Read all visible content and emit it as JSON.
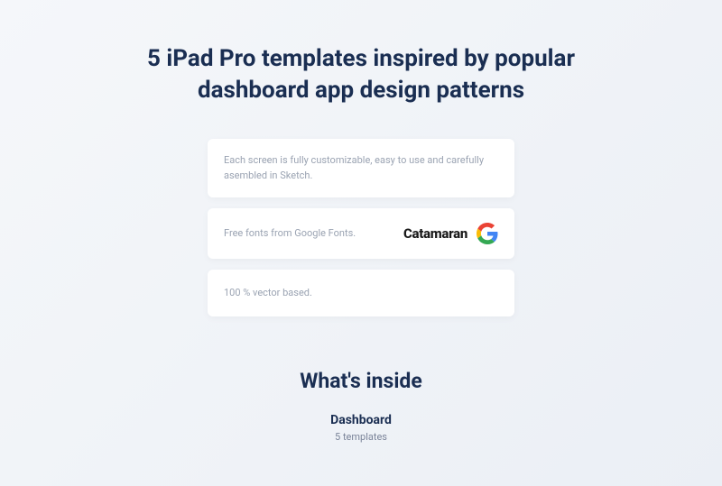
{
  "heading": "5 iPad Pro templates inspired by popular dashboard app design patterns",
  "cards": {
    "card1": "Each screen is fully customizable, easy to use and carefully asembled in Sketch.",
    "card2_text": "Free fonts from Google Fonts.",
    "card2_font": "Catamaran",
    "card3": "100 % vector based."
  },
  "inside": {
    "heading": "What's inside",
    "category_title": "Dashboard",
    "category_sub": "5 templates"
  }
}
